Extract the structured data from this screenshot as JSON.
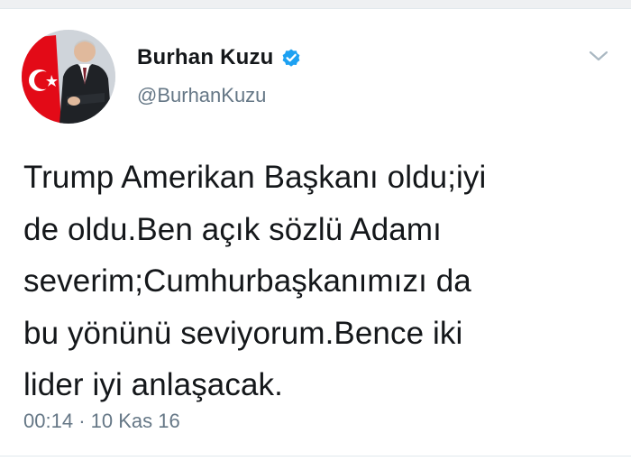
{
  "author": {
    "display_name": "Burhan Kuzu",
    "handle": "@BurhanKuzu",
    "verified": true
  },
  "tweet": {
    "text": "Trump Amerikan Başkanı oldu;iyi\nde oldu.Ben açık sözlü Adamı\nseverim;Cumhurbaşkanımızı da\nbu yönünü seviyorum.Bence iki\nlider iyi anlaşacak.",
    "time": "00:14",
    "separator": "·",
    "date": "10 Kas 16"
  },
  "icons": {
    "verified": "verified-badge-icon",
    "menu": "chevron-down-icon"
  },
  "colors": {
    "verified_blue": "#1da1f2",
    "text": "#14171a",
    "secondary": "#657786",
    "flag_red": "#e30a17"
  }
}
